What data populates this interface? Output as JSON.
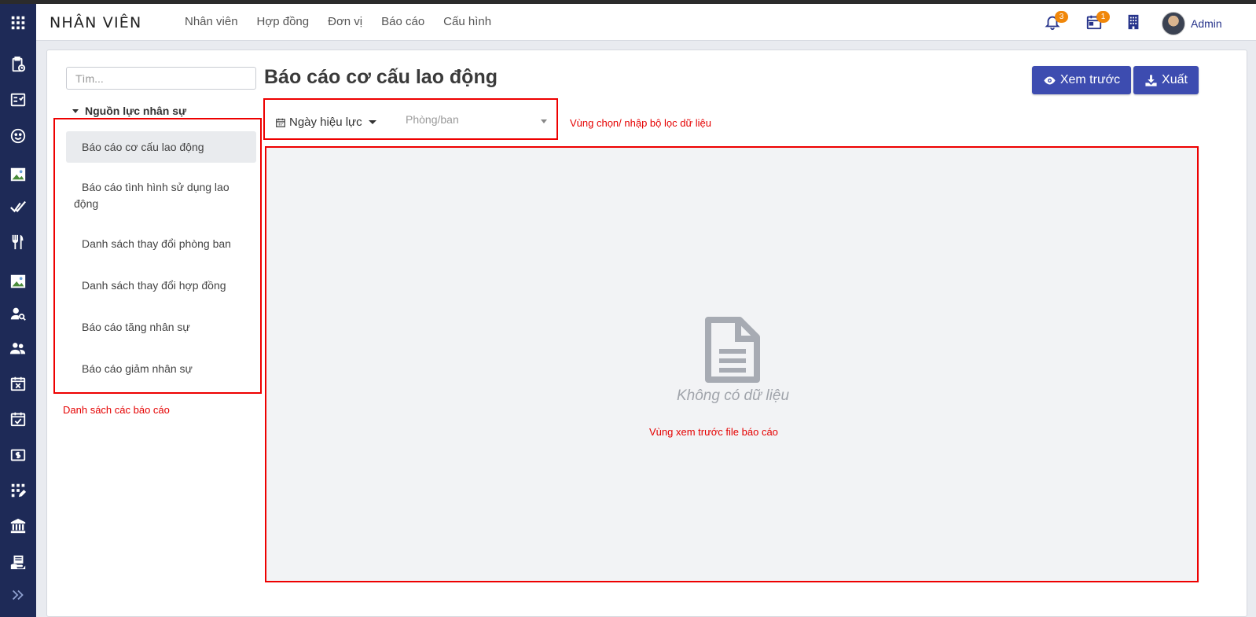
{
  "app": {
    "title": "NHÂN VIÊN",
    "menu": [
      "Nhân viên",
      "Hợp đồng",
      "Đơn vị",
      "Báo cáo",
      "Cấu hình"
    ],
    "notifications_count": "3",
    "calendar_count": "1",
    "user_name": "Admin"
  },
  "sidebar": {
    "search_placeholder": "Tìm...",
    "group_label": "Nguồn lực nhân sự",
    "items": [
      "Báo cáo cơ cấu lao động",
      "Báo cáo tình hình sử dụng lao động",
      "Danh sách thay đổi phòng ban",
      "Danh sách thay đổi hợp đồng",
      "Báo cáo tăng nhân sự",
      "Báo cáo giảm nhân sự"
    ],
    "active_index": 0
  },
  "main": {
    "title": "Báo cáo cơ cấu lao động",
    "preview_button": "Xem trước",
    "export_button": "Xuất",
    "filter_date_label": "Ngày hiệu lực",
    "filter_department_placeholder": "Phòng/ban",
    "empty_text": "Không có dữ liệu"
  },
  "annotations": {
    "filter_area": "Vùng chọn/ nhập bộ lọc dữ liệu",
    "report_list": "Danh sách các báo cáo",
    "preview_area": "Vùng xem trước file báo cáo"
  },
  "colors": {
    "rail": "#1e2a57",
    "accent": "#3d4cb0",
    "badge": "#f0870a",
    "annotation": "#ee0000"
  }
}
